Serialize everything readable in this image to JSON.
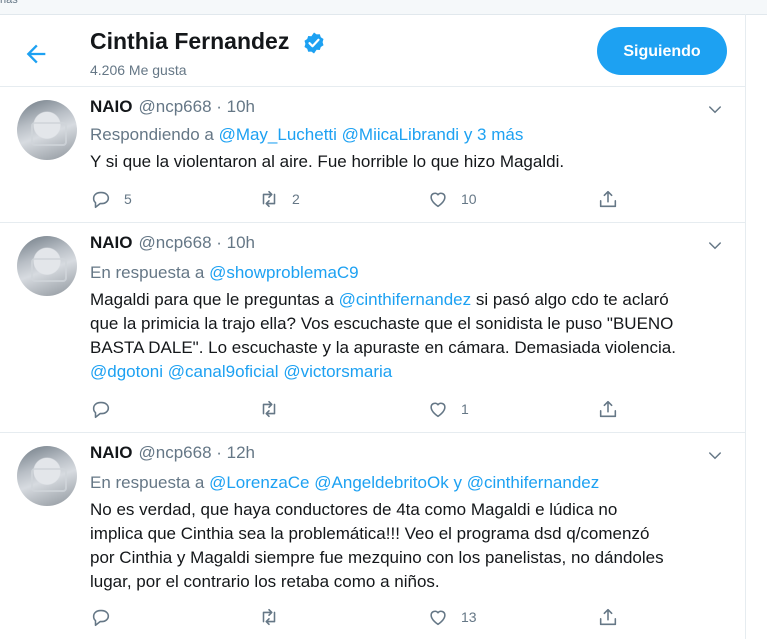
{
  "top_strip": {
    "text": "nas"
  },
  "header": {
    "name": "Cinthia Fernandez",
    "likes": "4.206 Me gusta",
    "follow_button": "Siguiendo"
  },
  "tweets": [
    {
      "author": "NAIO",
      "meta": "@ncp668 · 10h",
      "reply_prefix": "Respondiendo a",
      "reply_links": [
        "@May_Luchetti",
        "@MiicaLibrandi",
        "y 3 más"
      ],
      "text_lines": [
        "Y si que la violentaron al aire. Fue horrible lo que hizo Magaldi."
      ],
      "stats": {
        "replies": "5",
        "retweets": "2",
        "likes": "10"
      }
    },
    {
      "author": "NAIO",
      "meta": "@ncp668 · 10h",
      "reply_prefix": "En respuesta a",
      "reply_links": [
        "@showproblemaC9"
      ],
      "text_lines": [
        "Magaldi para que le preguntas a",
        "@cinthifernandez",
        "si pasó algo cdo te aclaró",
        "que la primicia la trajo ella? Vos escuchaste que el sonidista le puso \"BUENO",
        "BASTA DALE\". Lo escuchaste y la apuraste en cámara. Demasiada violencia.",
        "@dgotoni",
        "@canal9oficial",
        "@victorsmaria"
      ],
      "stats": {
        "replies": "",
        "retweets": "",
        "likes": "1"
      }
    },
    {
      "author": "NAIO",
      "meta": "@ncp668 · 12h",
      "reply_prefix": "En respuesta a",
      "reply_links": [
        "@LorenzaCe",
        "@AngeldebritoOk",
        "y",
        "@cinthifernandez"
      ],
      "text_lines": [
        "No es verdad, que haya conductores de 4ta como Magaldi e lúdica no",
        "implica que Cinthia sea la problemática!!! Veo el programa dsd q/comenzó",
        "por Cinthia y Magaldi siempre fue mezquino con los panelistas, no dándoles",
        "lugar, por el contrario los retaba como a niños."
      ],
      "stats": {
        "replies": "",
        "retweets": "",
        "likes": "13"
      }
    }
  ],
  "icons": {
    "back": "back-arrow-icon",
    "verified": "verified-badge-icon",
    "caret": "chevron-down-icon",
    "reply": "reply-icon",
    "retweet": "retweet-icon",
    "like": "heart-icon",
    "share": "share-icon"
  },
  "colors": {
    "accent": "#1da1f2",
    "text": "#14171a",
    "secondary": "#657786",
    "divider": "#e6ecf0"
  }
}
